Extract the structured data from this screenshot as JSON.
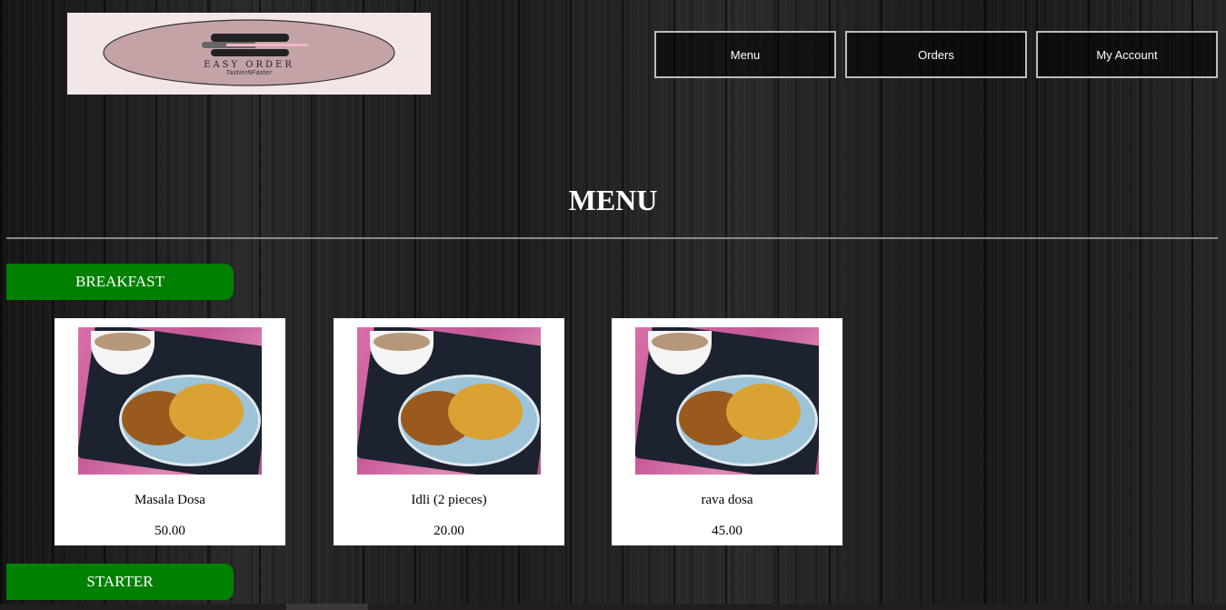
{
  "logo": {
    "line1": "EASY ORDER",
    "line2": "TastierNFaster",
    "colors": {
      "bg": "#f3e6e7",
      "oval": "#c4a3a6"
    }
  },
  "nav": [
    {
      "label": "Menu"
    },
    {
      "label": "Orders"
    },
    {
      "label": "My Account"
    }
  ],
  "page_title": "MENU",
  "categories": [
    {
      "label": "BREAKFAST"
    },
    {
      "label": "STARTER"
    }
  ],
  "items": [
    {
      "name": "Masala Dosa",
      "price": "50.00"
    },
    {
      "name": "Idli (2 pieces)",
      "price": "20.00"
    },
    {
      "name": "rava dosa",
      "price": "45.00"
    }
  ],
  "colors": {
    "category_bg": "#008000",
    "card_bg": "#ffffff"
  },
  "scrollbar": {
    "thumb_position": 0.25
  }
}
